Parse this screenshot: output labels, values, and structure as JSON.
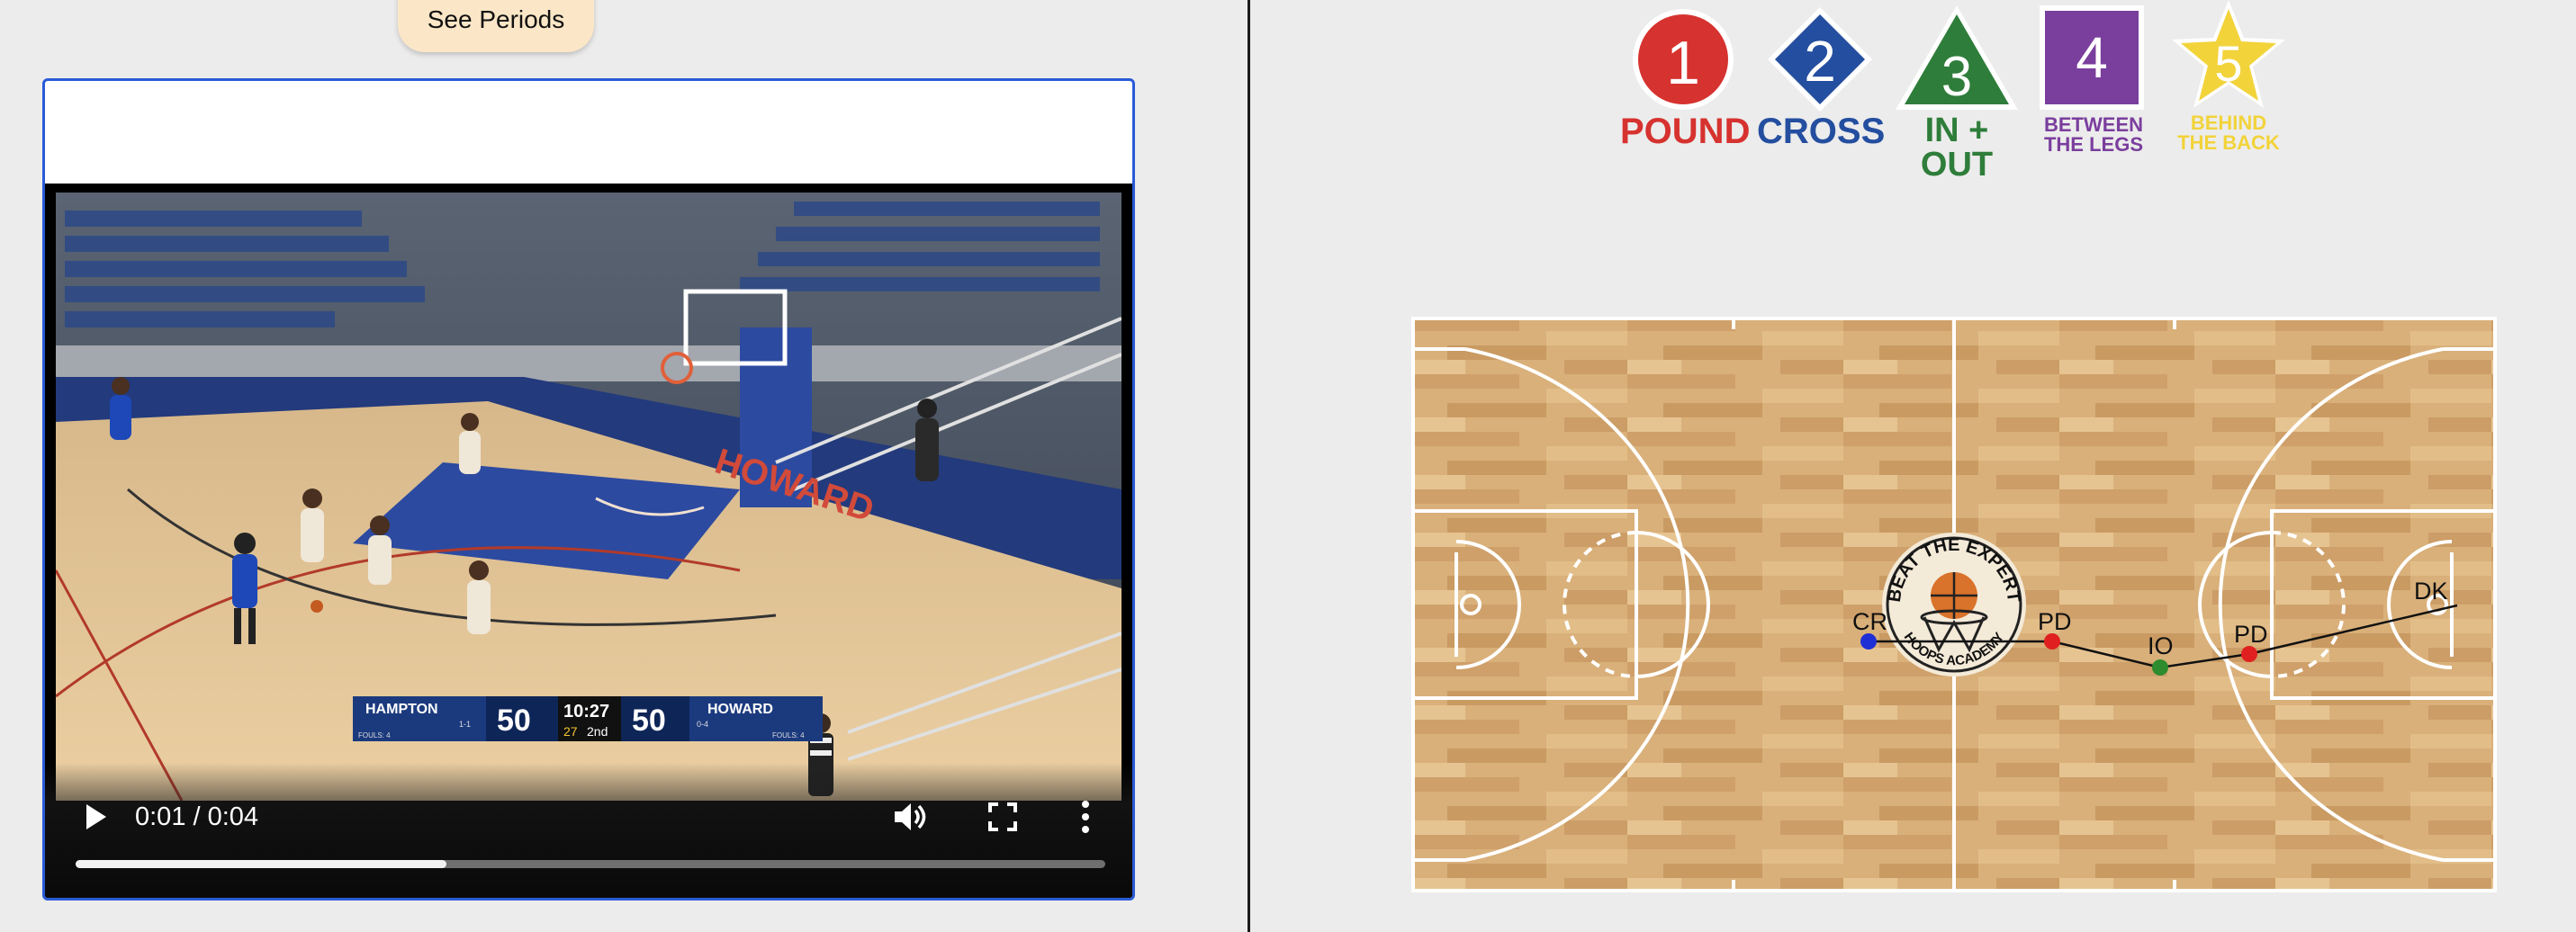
{
  "left_panel": {
    "see_periods_label": "See Periods",
    "video": {
      "time_display": "0:01 / 0:04",
      "progress_fraction": 0.36,
      "scoreboard": {
        "home_team": "HAMPTON",
        "home_record": "1-1",
        "home_score": "50",
        "home_fouls": "FOULS: 4",
        "clock": "10:27",
        "shot_clock": "27",
        "period": "2nd",
        "away_score": "50",
        "away_team": "HOWARD",
        "away_record": "0-4",
        "away_fouls": "FOULS: 4"
      },
      "court_text": "HOWARD"
    }
  },
  "legend": [
    {
      "number": "1",
      "label_lines": [
        "POUND"
      ],
      "shape": "circle",
      "color": "#d6322f"
    },
    {
      "number": "2",
      "label_lines": [
        "CROSS"
      ],
      "shape": "diamond",
      "color": "#244e9f"
    },
    {
      "number": "3",
      "label_lines": [
        "IN + OUT"
      ],
      "shape": "triangle",
      "color": "#2e7d3a"
    },
    {
      "number": "4",
      "label_lines": [
        "BETWEEN",
        "THE LEGS"
      ],
      "shape": "square",
      "color": "#7a3e9d"
    },
    {
      "number": "5",
      "label_lines": [
        "BEHIND",
        "THE BACK"
      ],
      "shape": "star",
      "color": "#f2d33a"
    }
  ],
  "court": {
    "logo_text_top": "BEAT THE EXPERT",
    "logo_text_bottom": "HOOPS ACADEMY",
    "path_nodes": [
      {
        "label": "CR",
        "color": "#1f2fd6"
      },
      {
        "label": "PD",
        "color": "#e02020"
      },
      {
        "label": "IO",
        "color": "#2e8b2e"
      },
      {
        "label": "PD",
        "color": "#e02020"
      },
      {
        "label": "DK",
        "color": "#ffffff"
      }
    ]
  }
}
